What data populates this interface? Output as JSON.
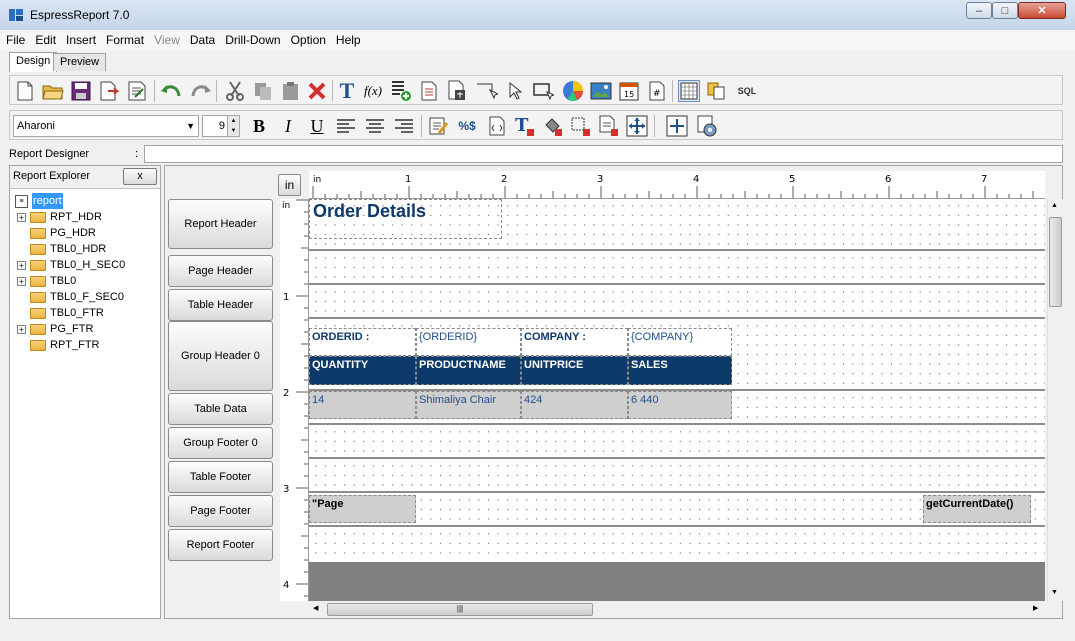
{
  "window": {
    "title": "EspressReport 7.0"
  },
  "menu": [
    "File",
    "Edit",
    "Insert",
    "Format",
    "View",
    "Data",
    "Drill-Down",
    "Option",
    "Help"
  ],
  "menu_disabled": [
    "View"
  ],
  "tabs": {
    "design": "Design",
    "preview": "Preview"
  },
  "toolbar1_icons": [
    "new-file-icon",
    "open-folder-icon",
    "save-icon",
    "export-icon",
    "page-setup-icon",
    "undo-icon",
    "redo-icon",
    "cut-icon",
    "copy-icon",
    "paste-icon",
    "delete-icon",
    "text-icon",
    "formula-icon",
    "add-column-icon",
    "insert-table-icon",
    "import-icon",
    "line-icon",
    "pointer-icon",
    "rectangle-icon",
    "pie-chart-icon",
    "image-icon",
    "date-icon",
    "page-number-icon",
    "grid-icon",
    "layers-icon",
    "sql-icon"
  ],
  "toolbar1_sql": "SQL",
  "toolbar1_date": "15",
  "toolbar1_page": "#",
  "toolbar2": {
    "font": "Aharoni",
    "size": "9",
    "bold": "B",
    "italic": "I",
    "underline": "U"
  },
  "report_designer": {
    "label": "Report Designer",
    "colon": ":",
    "value": ""
  },
  "explorer": {
    "title": "Report Explorer",
    "close": "x",
    "root": "report",
    "items": [
      {
        "label": "RPT_HDR",
        "expandable": true
      },
      {
        "label": "PG_HDR",
        "expandable": false
      },
      {
        "label": "TBL0_HDR",
        "expandable": false
      },
      {
        "label": "TBL0_H_SEC0",
        "expandable": true
      },
      {
        "label": "TBL0",
        "expandable": true
      },
      {
        "label": "TBL0_F_SEC0",
        "expandable": false
      },
      {
        "label": "TBL0_FTR",
        "expandable": false
      },
      {
        "label": "PG_FTR",
        "expandable": true
      },
      {
        "label": "RPT_FTR",
        "expandable": false
      }
    ]
  },
  "sections": [
    "Report Header",
    "Page Header",
    "Table Header",
    "Group Header 0",
    "Table Data",
    "Group Footer 0",
    "Table Footer",
    "Page Footer",
    "Report Footer"
  ],
  "ruler": {
    "unit": "in",
    "h_labels": [
      "1",
      "2",
      "3",
      "4",
      "5",
      "6",
      "7"
    ],
    "v_labels": [
      "1",
      "2",
      "3",
      "4"
    ]
  },
  "report": {
    "title": "Order Details",
    "orderid_label": "ORDERID :",
    "orderid_value": "{ORDERID}",
    "company_label": "COMPANY :",
    "company_value": "{COMPANY}",
    "headers": [
      "QUANTITY",
      "PRODUCTNAME",
      "UNITPRICE",
      "SALES"
    ],
    "row": [
      "14",
      "Shimaliya Chair",
      "424",
      "6 440"
    ],
    "page_footer_left": "\"Page",
    "page_footer_right": "getCurrentDate()"
  },
  "colors": {
    "header_fill": "#0e3a6b",
    "title_color": "#0e3a6b",
    "value_color": "#1f4f8a",
    "cell_gray": "#cfcfcf"
  }
}
